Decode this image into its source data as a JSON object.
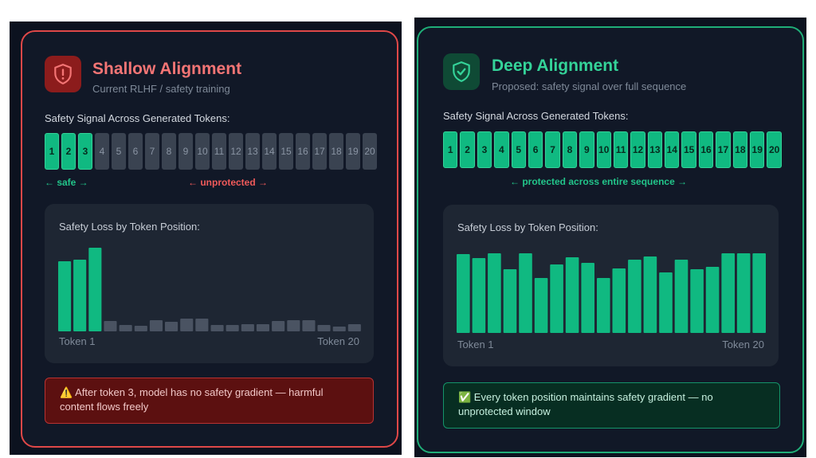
{
  "left": {
    "title": "Shallow Alignment",
    "subtitle": "Current RLHF / safety training",
    "tokens_label": "Safety Signal Across Generated Tokens:",
    "tokens": [
      "1",
      "2",
      "3",
      "4",
      "5",
      "6",
      "7",
      "8",
      "9",
      "10",
      "11",
      "12",
      "13",
      "14",
      "15",
      "16",
      "17",
      "18",
      "19",
      "20"
    ],
    "safe_tokens": 3,
    "safe_range_label": "← safe →",
    "unsafe_range_label": "← unprotected →",
    "chart": {
      "title": "Safety Loss by Token Position:",
      "x_start_label": "Token 1",
      "x_end_label": "Token 20"
    },
    "note": "⚠️ After token 3, model has no safety gradient — harmful content flows freely"
  },
  "right": {
    "title": "Deep Alignment",
    "subtitle": "Proposed: safety signal over full sequence",
    "tokens_label": "Safety Signal Across Generated Tokens:",
    "tokens": [
      "1",
      "2",
      "3",
      "4",
      "5",
      "6",
      "7",
      "8",
      "9",
      "10",
      "11",
      "12",
      "13",
      "14",
      "15",
      "16",
      "17",
      "18",
      "19",
      "20"
    ],
    "safe_tokens": 20,
    "range_label": "← protected across entire sequence →",
    "chart": {
      "title": "Safety Loss by Token Position:",
      "x_start_label": "Token 1",
      "x_end_label": "Token 20"
    },
    "note": "✅ Every token position maintains safety gradient — no unprotected window"
  },
  "chart_data": [
    {
      "type": "bar",
      "title": "Safety Loss by Token Position:",
      "categories": [
        "1",
        "2",
        "3",
        "4",
        "5",
        "6",
        "7",
        "8",
        "9",
        "10",
        "11",
        "12",
        "13",
        "14",
        "15",
        "16",
        "17",
        "18",
        "19",
        "20"
      ],
      "values": [
        88,
        90,
        105,
        13,
        8,
        7,
        14,
        12,
        16,
        16,
        8,
        8,
        9,
        9,
        13,
        14,
        14,
        8,
        6,
        9
      ],
      "ylim": [
        0,
        110
      ],
      "colors": {
        "high": "#10b981",
        "low": "#4a5362"
      }
    },
    {
      "type": "bar",
      "title": "Safety Loss by Token Position:",
      "categories": [
        "1",
        "2",
        "3",
        "4",
        "5",
        "6",
        "7",
        "8",
        "9",
        "10",
        "11",
        "12",
        "13",
        "14",
        "15",
        "16",
        "17",
        "18",
        "19",
        "20"
      ],
      "values": [
        99,
        94,
        100,
        80,
        100,
        69,
        86,
        95,
        88,
        69,
        81,
        92,
        96,
        76,
        92,
        80,
        83,
        100,
        100,
        100
      ],
      "ylim": [
        0,
        110
      ],
      "colors": {
        "high": "#10b981",
        "low": "#4a5362"
      }
    }
  ]
}
